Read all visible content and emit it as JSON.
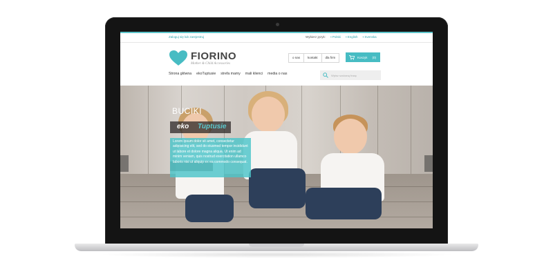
{
  "topbar": {
    "login_text": "Zaloguj się lub zarejestruj",
    "language_label": "Wybierz język:",
    "languages": [
      "Polski",
      "English",
      "Svenska"
    ]
  },
  "logo": {
    "name": "FIORINO",
    "tagline": "Mother & Child Accessories"
  },
  "header_links": [
    "o nas",
    "kontakt",
    "dla firm"
  ],
  "cart": {
    "label": "Koszyk",
    "count": "(0)"
  },
  "nav": [
    "Strona główna",
    "ekoTuptusie",
    "strefa mamy",
    "mali klienci",
    "media o nas"
  ],
  "search": {
    "placeholder": "Wpisz szukaną frazę"
  },
  "hero": {
    "title": "BUCIKI",
    "brand_part1": "eko",
    "brand_part2": "Tuptusie",
    "body": "Lorem ipsum dolor sit amet, consectetur adipisicing elit, sed do eiusmod tempor incididunt ut labore et dolore magna aliqua. Ut enim ad minim veniam, quis nostrud exercitation ullamco laboris nisi ut aliquip ex ea commodo consequat."
  },
  "colors": {
    "accent": "#47bcc3",
    "text": "#444444"
  }
}
